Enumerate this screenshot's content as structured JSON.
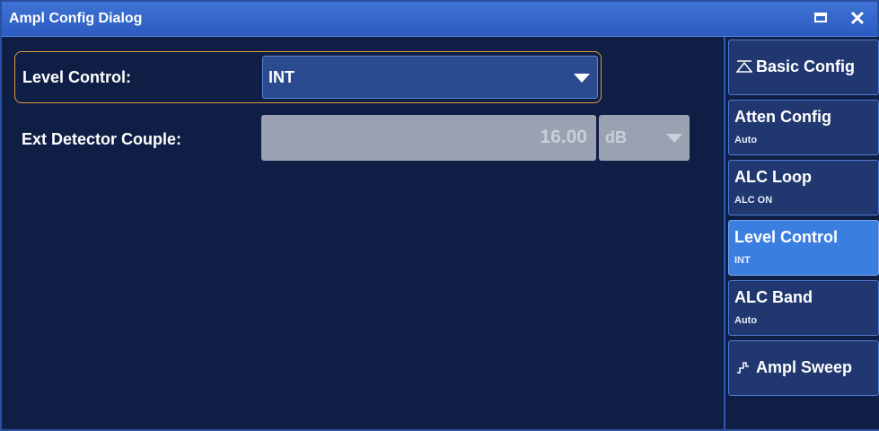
{
  "window": {
    "title": "Ampl Config Dialog"
  },
  "level_control": {
    "label": "Level Control:",
    "value": "INT"
  },
  "ext_detector": {
    "label": "Ext Detector Couple:",
    "value": "16.00",
    "unit": "dB"
  },
  "sidebar": {
    "items": [
      {
        "label": "Basic Config",
        "sub": "",
        "icon": "triangle-up-icon"
      },
      {
        "label": "Atten Config",
        "sub": "Auto"
      },
      {
        "label": "ALC Loop",
        "sub": "ALC ON"
      },
      {
        "label": "Level Control",
        "sub": "INT"
      },
      {
        "label": "ALC Band",
        "sub": "Auto"
      },
      {
        "label": "Ampl Sweep",
        "sub": "",
        "icon": "step-waveform-icon"
      }
    ]
  },
  "colors": {
    "title_bar": "#3f73d6",
    "panel": "#0f1e44",
    "active_button": "#3a7fe0",
    "focus_border": "#e09a3a"
  }
}
